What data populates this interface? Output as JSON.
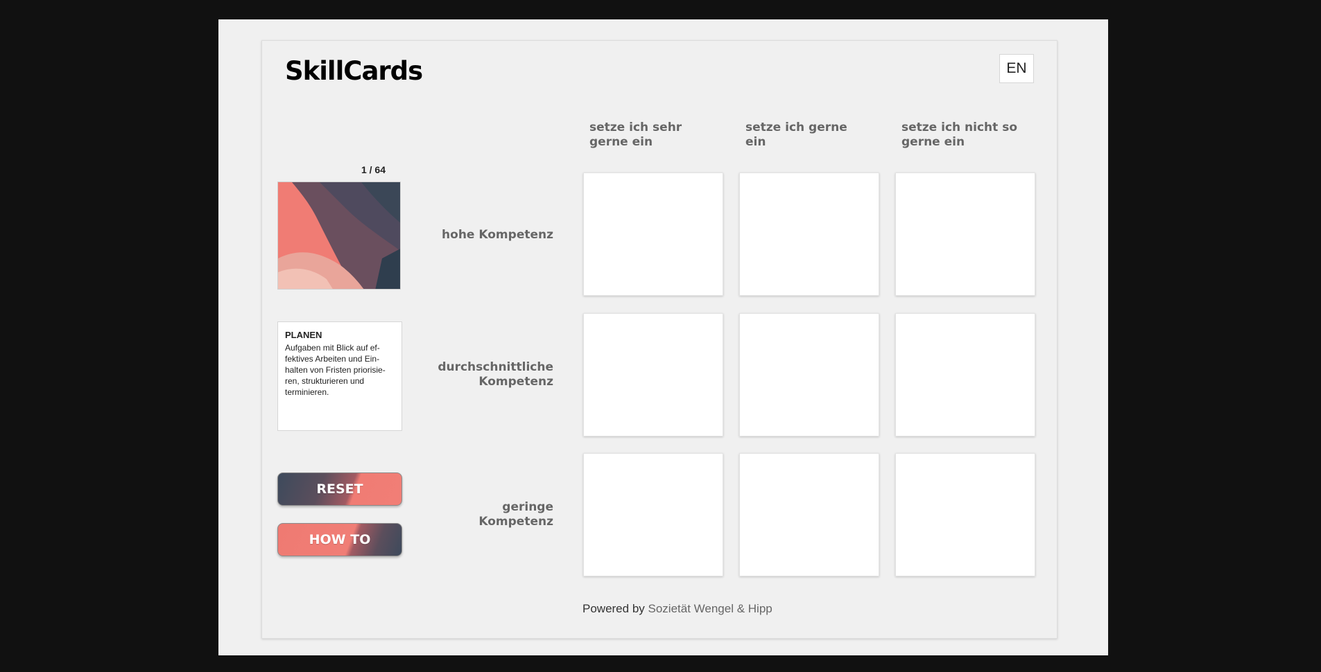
{
  "app": {
    "title": "SkillCards",
    "language_button": "EN"
  },
  "columns": [
    {
      "label": "setze ich sehr gerne ein"
    },
    {
      "label": "setze ich gerne ein"
    },
    {
      "label": "setze ich nicht so gerne ein"
    }
  ],
  "rows": [
    {
      "label": "hohe Kompetenz"
    },
    {
      "label": "durchschnittliche Kompetenz"
    },
    {
      "label": "geringe Kompetenz"
    }
  ],
  "deck": {
    "counter": "1 / 64",
    "current_card": {
      "title": "PLANEN",
      "description": "Aufgaben mit Blick auf ef-fektives Arbeiten und Ein-halten von Fristen priorisie-ren, strukturieren und terminieren."
    }
  },
  "buttons": {
    "reset": "RESET",
    "howto": "HOW TO"
  },
  "footer": {
    "prefix": "Powered by ",
    "link": "Sozietät Wengel & Hipp"
  },
  "colors": {
    "coral": "#f07c74",
    "slate": "#3d4a5c",
    "background": "#f0f0f0"
  }
}
